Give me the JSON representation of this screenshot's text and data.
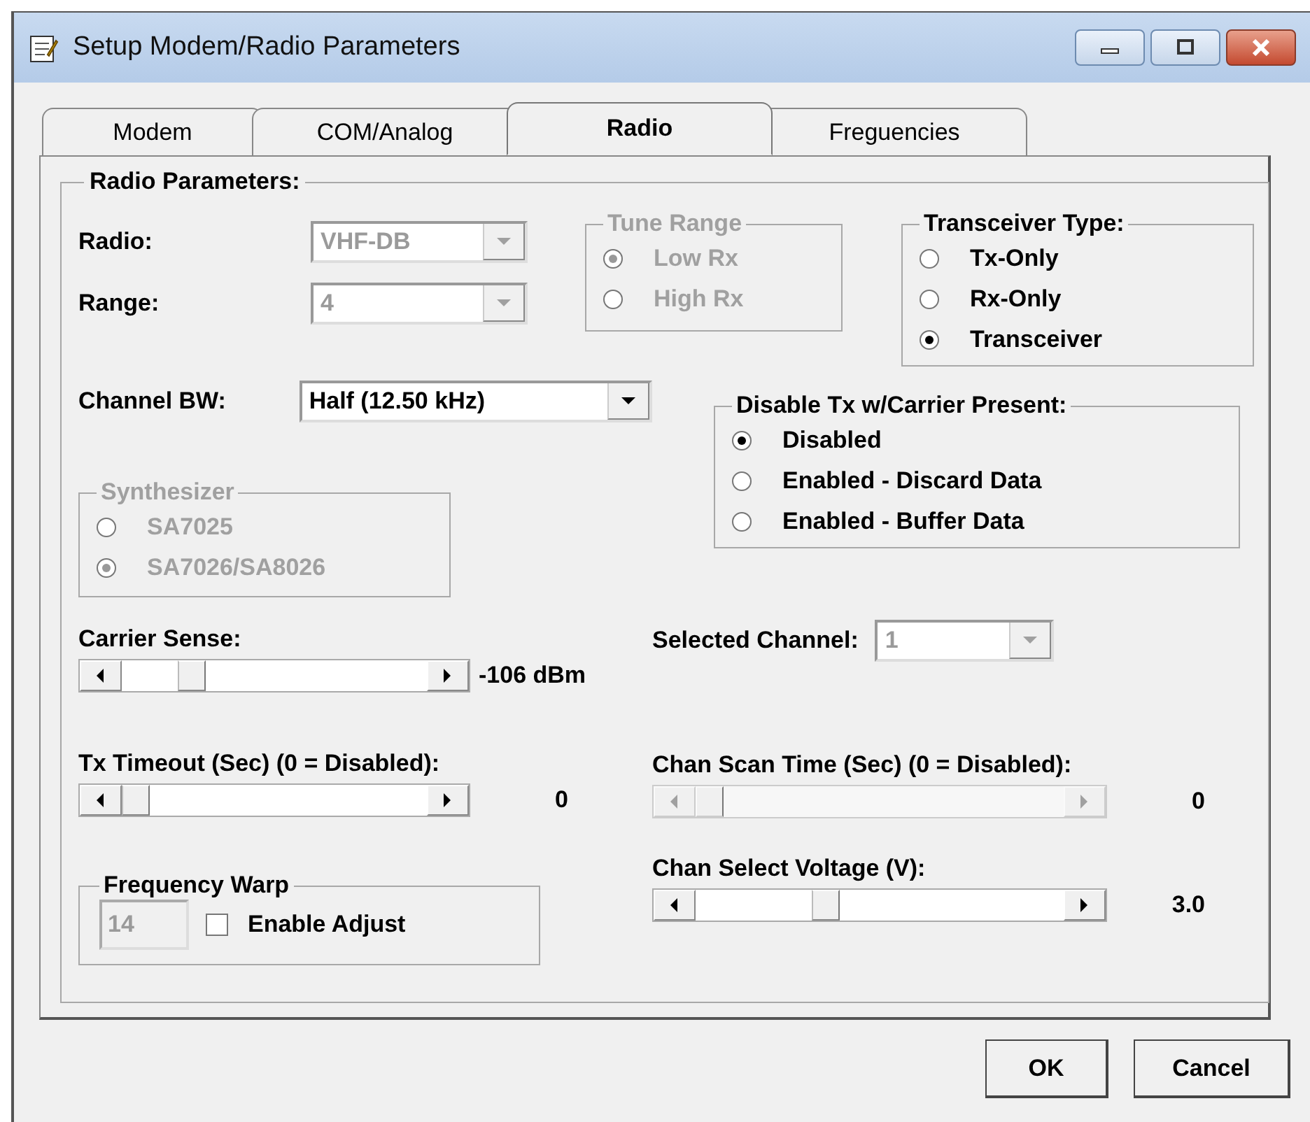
{
  "window": {
    "title": "Setup Modem/Radio Parameters"
  },
  "tabs": [
    {
      "label": "Modem",
      "selected": false
    },
    {
      "label": "COM/Analog",
      "selected": false
    },
    {
      "label": "Radio",
      "selected": true
    },
    {
      "label": "Freguencies",
      "selected": false
    }
  ],
  "group_title": "Radio Parameters:",
  "combos_top": [
    {
      "label": "Radio:",
      "value": "VHF-DB",
      "disabled": true
    },
    {
      "label": "Range:",
      "value": "4",
      "disabled": true
    }
  ],
  "tune_range": {
    "title": "Tune Range",
    "disabled": true,
    "options": [
      {
        "label": "Low Rx",
        "selected": true
      },
      {
        "label": "High Rx",
        "selected": false
      }
    ]
  },
  "transceiver_type": {
    "title": "Transceiver Type:",
    "disabled": false,
    "options": [
      {
        "label": "Tx-Only",
        "selected": false
      },
      {
        "label": "Rx-Only",
        "selected": false
      },
      {
        "label": "Transceiver",
        "selected": true
      }
    ]
  },
  "channel_bw": {
    "label": "Channel BW:",
    "value": "Half (12.50 kHz)",
    "disabled": false
  },
  "disable_tx": {
    "title": "Disable Tx w/Carrier Present:",
    "disabled": false,
    "options": [
      {
        "label": "Disabled",
        "selected": true
      },
      {
        "label": "Enabled - Discard Data",
        "selected": false
      },
      {
        "label": "Enabled - Buffer Data",
        "selected": false
      }
    ]
  },
  "synthesizer": {
    "title": "Synthesizer",
    "disabled": true,
    "options": [
      {
        "label": "SA7025",
        "selected": false
      },
      {
        "label": "SA7026/SA8026",
        "selected": true
      }
    ]
  },
  "selected_channel": {
    "label": "Selected Channel:",
    "value": "1",
    "disabled": true
  },
  "left_sliders": [
    {
      "label": "Carrier Sense:",
      "level": 0.2,
      "reading": "-106 dBm",
      "disabled": false
    },
    {
      "label": "Tx Timeout (Sec) (0 = Disabled):",
      "level": 0,
      "reading": "0",
      "disabled": false
    }
  ],
  "right_sliders": [
    {
      "label": "Chan Scan Time (Sec) (0 = Disabled):",
      "level": 0,
      "reading": "0",
      "disabled": true
    },
    {
      "label": "Chan Select Voltage (V):",
      "level": 0.34,
      "reading": "3.0",
      "disabled": false
    }
  ],
  "frequency_warp": {
    "title": "Frequency Warp",
    "value": "14",
    "disabled": true,
    "checkbox": {
      "label": "Enable Adjust",
      "checked": false
    }
  },
  "buttons": [
    {
      "label": "OK"
    },
    {
      "label": "Cancel"
    }
  ]
}
